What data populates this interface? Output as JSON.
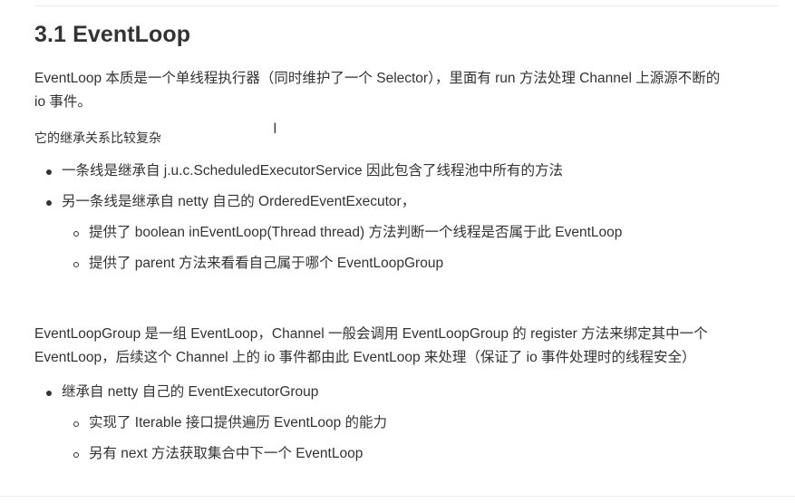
{
  "heading": "3.1 EventLoop",
  "para1": {
    "line1": "EventLoop 本质是一个单线程执行器（同时维护了一个 Selector），里面有 run 方法处理 Channel 上源源不断的",
    "line2": "io 事件。"
  },
  "inheritance_note": "它的继承关系比较复杂",
  "list1": {
    "item1": "一条线是继承自 j.u.c.ScheduledExecutorService 因此包含了线程池中所有的方法",
    "item2": "另一条线是继承自 netty 自己的 OrderedEventExecutor，",
    "sub1": "提供了 boolean inEventLoop(Thread thread) 方法判断一个线程是否属于此 EventLoop",
    "sub2": "提供了 parent 方法来看看自己属于哪个 EventLoopGroup"
  },
  "para2": {
    "line1": "EventLoopGroup 是一组 EventLoop，Channel 一般会调用 EventLoopGroup 的 register 方法来绑定其中一个",
    "line2": "EventLoop，后续这个 Channel 上的 io 事件都由此 EventLoop 来处理（保证了 io 事件处理时的线程安全）"
  },
  "list2": {
    "item1": "继承自 netty 自己的 EventExecutorGroup",
    "sub1": "实现了 Iterable 接口提供遍历 EventLoop 的能力",
    "sub2": "另有 next 方法获取集合中下一个 EventLoop"
  },
  "cursor_icon": "text-cursor-icon"
}
